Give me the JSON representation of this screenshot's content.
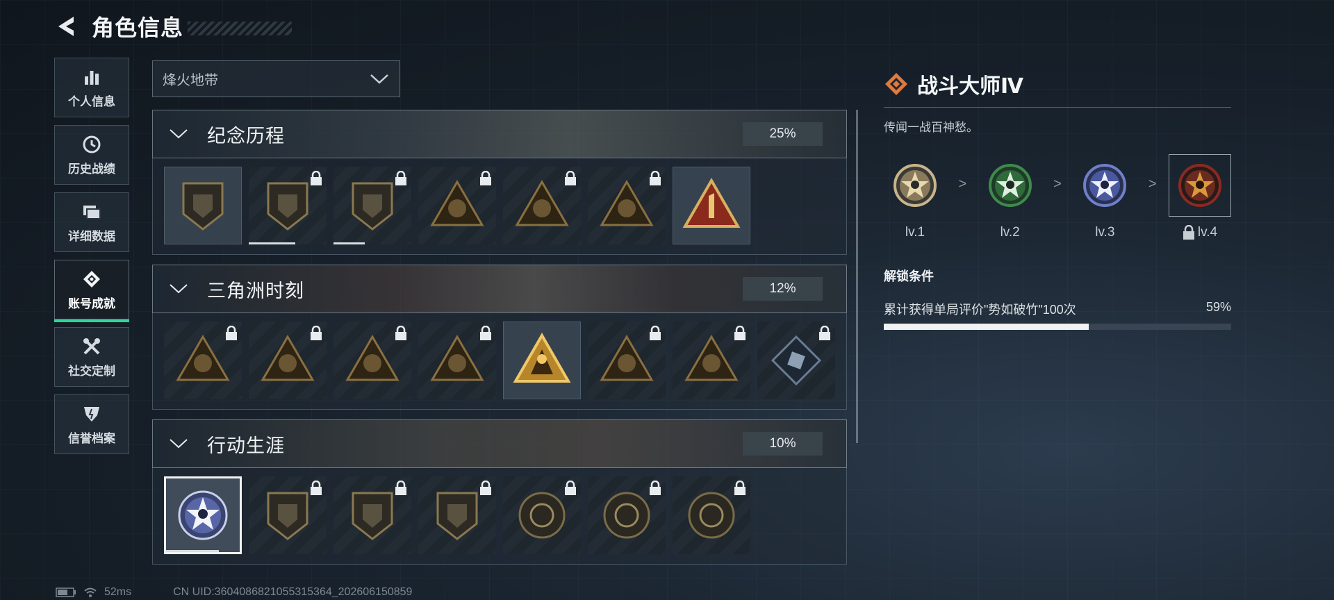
{
  "header": {
    "title": "角色信息"
  },
  "sidebar": {
    "items": [
      {
        "label": "个人信息",
        "icon": "bar-chart-icon"
      },
      {
        "label": "历史战绩",
        "icon": "clock-icon"
      },
      {
        "label": "详细数据",
        "icon": "folder-icon"
      },
      {
        "label": "账号成就",
        "icon": "achievement-icon",
        "active": true
      },
      {
        "label": "社交定制",
        "icon": "tools-icon"
      },
      {
        "label": "信誉档案",
        "icon": "shield-icon"
      }
    ]
  },
  "mode_dropdown": {
    "value": "烽火地带"
  },
  "sections": [
    {
      "title": "纪念历程",
      "percent": "25%",
      "badges": [
        {
          "icon": "triangle-emblem-icon",
          "locked": false,
          "shape": "shield"
        },
        {
          "icon": "helicopter-emblem-icon",
          "locked": true,
          "shape": "shield",
          "progress": 0.6
        },
        {
          "icon": "diamond-emblem-icon",
          "locked": true,
          "shape": "shield",
          "progress": 0.4
        },
        {
          "icon": "gunner-emblem-icon",
          "locked": true,
          "shape": "triangle"
        },
        {
          "icon": "hooded-figure-emblem-icon",
          "locked": true,
          "shape": "triangle"
        },
        {
          "icon": "soldier-emblem-icon",
          "locked": true,
          "shape": "triangle"
        },
        {
          "icon": "number-one-emblem-icon",
          "locked": false,
          "shape": "triangle-red"
        }
      ]
    },
    {
      "title": "三角洲时刻",
      "percent": "12%",
      "badges": [
        {
          "icon": "box-emblem-icon",
          "locked": true,
          "shape": "triangle"
        },
        {
          "icon": "skull-emblem-icon",
          "locked": true,
          "shape": "triangle"
        },
        {
          "icon": "kneeling-soldier-emblem-icon",
          "locked": true,
          "shape": "triangle"
        },
        {
          "icon": "hands-emblem-icon",
          "locked": true,
          "shape": "triangle"
        },
        {
          "icon": "squad-emblem-icon",
          "locked": false,
          "shape": "triangle-gold"
        },
        {
          "icon": "team-emblem-icon",
          "locked": true,
          "shape": "triangle"
        },
        {
          "icon": "dragon-emblem-icon",
          "locked": true,
          "shape": "triangle"
        },
        {
          "icon": "crystal-emblem-icon",
          "locked": true,
          "shape": "diamond"
        }
      ]
    },
    {
      "title": "行动生涯",
      "percent": "10%",
      "badges": [
        {
          "icon": "star-emblem-icon",
          "locked": false,
          "shape": "circle-blue",
          "selected": true,
          "progress": 0.72
        },
        {
          "icon": "chevron-shield-emblem-icon",
          "locked": true,
          "shape": "shield"
        },
        {
          "icon": "split-shield-emblem-icon",
          "locked": true,
          "shape": "shield"
        },
        {
          "icon": "hex-shield-emblem-icon",
          "locked": true,
          "shape": "shield"
        },
        {
          "icon": "shell-emblem-icon",
          "locked": true,
          "shape": "circle"
        },
        {
          "icon": "target-emblem-icon",
          "locked": true,
          "shape": "circle"
        },
        {
          "icon": "eye-emblem-icon",
          "locked": true,
          "shape": "circle"
        }
      ]
    }
  ],
  "detail": {
    "title": "战斗大师Ⅳ",
    "description": "传闻一战百神愁。",
    "levels": [
      {
        "label": "lv.1",
        "color": "#c8b48a",
        "locked": false
      },
      {
        "label": "lv.2",
        "color": "#3e8a4a",
        "locked": false
      },
      {
        "label": "lv.3",
        "color": "#6f7fc9",
        "locked": false
      },
      {
        "label": "lv.4",
        "color": "#8b2a22",
        "locked": true
      }
    ],
    "separator": ">",
    "unlock_title": "解锁条件",
    "condition_text": "累计获得单局评价\"势如破竹\"100次",
    "condition_percent": "59%",
    "condition_progress": 0.59
  },
  "footer": {
    "ping": "52ms",
    "uid": "CN UID:3604086821055315364_202606150859"
  },
  "colors": {
    "accent": "#2fd69a",
    "detail_icon": "#e07a3c"
  }
}
